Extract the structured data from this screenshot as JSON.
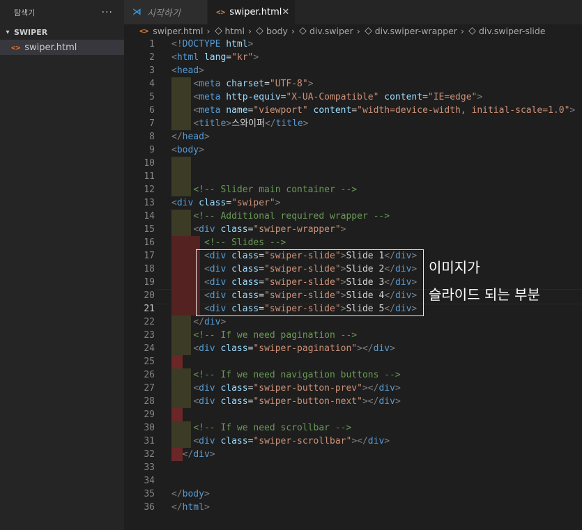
{
  "sidebar": {
    "title": "탐색기",
    "more": "···",
    "folder": "SWIPER",
    "file": "swiper.html",
    "file_icon": "<>"
  },
  "tabs": [
    {
      "label": "시작하기",
      "icon": "vscode-icon"
    },
    {
      "label": "swiper.html",
      "icon": "html-icon",
      "close": "✕"
    }
  ],
  "breadcrumb": [
    {
      "label": "swiper.html",
      "icon": "html-icon"
    },
    {
      "label": "html",
      "icon": "cube-icon"
    },
    {
      "label": "body",
      "icon": "cube-icon"
    },
    {
      "label": "div.swiper",
      "icon": "cube-icon"
    },
    {
      "label": "div.swiper-wrapper",
      "icon": "cube-icon"
    },
    {
      "label": "div.swiper-slide",
      "icon": "cube-icon"
    }
  ],
  "editor": {
    "active_line": 21,
    "lines": [
      "<!DOCTYPE html>",
      "<html lang=\"kr\">",
      "<head>",
      "    <meta charset=\"UTF-8\">",
      "    <meta http-equiv=\"X-UA-Compatible\" content=\"IE=edge\">",
      "    <meta name=\"viewport\" content=\"width=device-width, initial-scale=1.0\">",
      "    <title>스와이퍼</title>",
      "</head>",
      "<body>",
      "",
      "",
      "    <!-- Slider main container -->",
      "<div class=\"swiper\">",
      "    <!-- Additional required wrapper -->",
      "    <div class=\"swiper-wrapper\">",
      "      <!-- Slides -->",
      "      <div class=\"swiper-slide\">Slide 1</div>",
      "      <div class=\"swiper-slide\">Slide 2</div>",
      "      <div class=\"swiper-slide\">Slide 3</div>",
      "      <div class=\"swiper-slide\">Slide 4</div>",
      "      <div class=\"swiper-slide\">Slide 5</div>",
      "    </div>",
      "    <!-- If we need pagination -->",
      "    <div class=\"swiper-pagination\"></div>",
      "",
      "    <!-- If we need navigation buttons -->",
      "    <div class=\"swiper-button-prev\"></div>",
      "    <div class=\"swiper-button-next\"></div>",
      "",
      "    <!-- If we need scrollbar -->",
      "    <div class=\"swiper-scrollbar\"></div>",
      "  </div>",
      "",
      "",
      "</body>",
      "</html>"
    ]
  },
  "annotation": {
    "line1": "이미지가",
    "line2": "슬라이드 되는 부분"
  }
}
